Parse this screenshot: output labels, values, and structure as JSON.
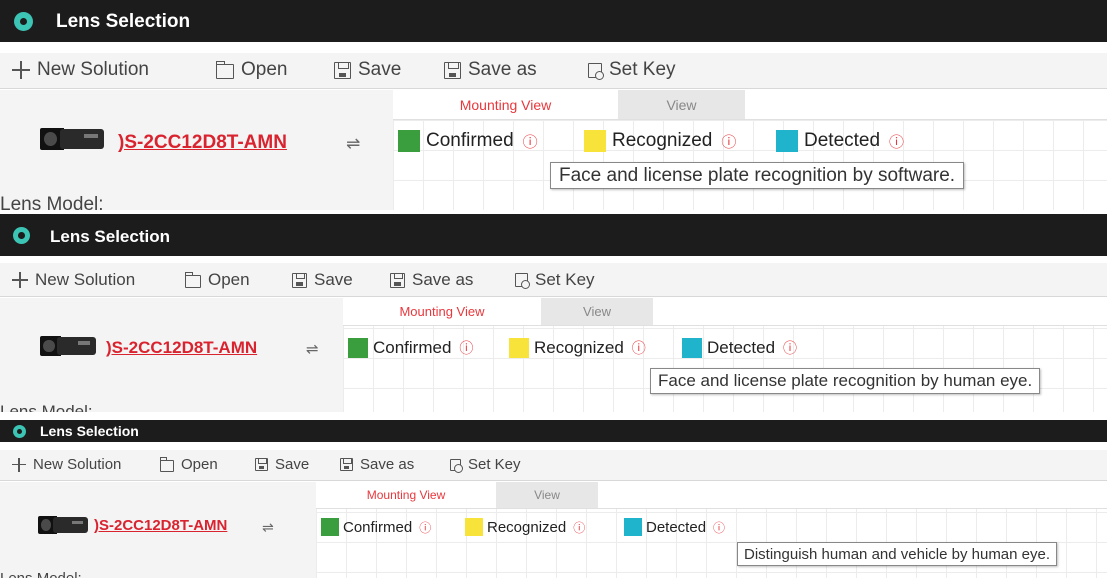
{
  "app": {
    "title": "Lens Selection"
  },
  "toolbar": {
    "new_solution": "New Solution",
    "open": "Open",
    "save": "Save",
    "save_as": "Save as",
    "set_key": "Set Key"
  },
  "camera": {
    "model": ")S-2CC12D8T-AMN",
    "swap_icon": "⇌",
    "lens_model_label": "Lens Model:"
  },
  "tabs": {
    "mounting_view": "Mounting View",
    "view": "View"
  },
  "legend": {
    "confirmed": "Confirmed",
    "recognized": "Recognized",
    "detected": "Detected",
    "info_icon": "ⓘ"
  },
  "tooltips": {
    "panel1": "Face and license plate recognition by software.",
    "panel2": "Face and license plate recognition by human eye.",
    "panel3": "Distinguish human and vehicle by human eye."
  },
  "colors": {
    "confirmed": "#3a9e3e",
    "recognized": "#f7e33a",
    "detected": "#20b3cc",
    "accent": "#e8383d",
    "titlebar": "#1c1c1c"
  },
  "icons": {
    "app": "lens-app-icon",
    "new": "plus-icon",
    "open": "folder-icon",
    "save": "save-icon",
    "save_as": "save-as-icon",
    "set_key": "key-icon",
    "info": "info-icon"
  }
}
